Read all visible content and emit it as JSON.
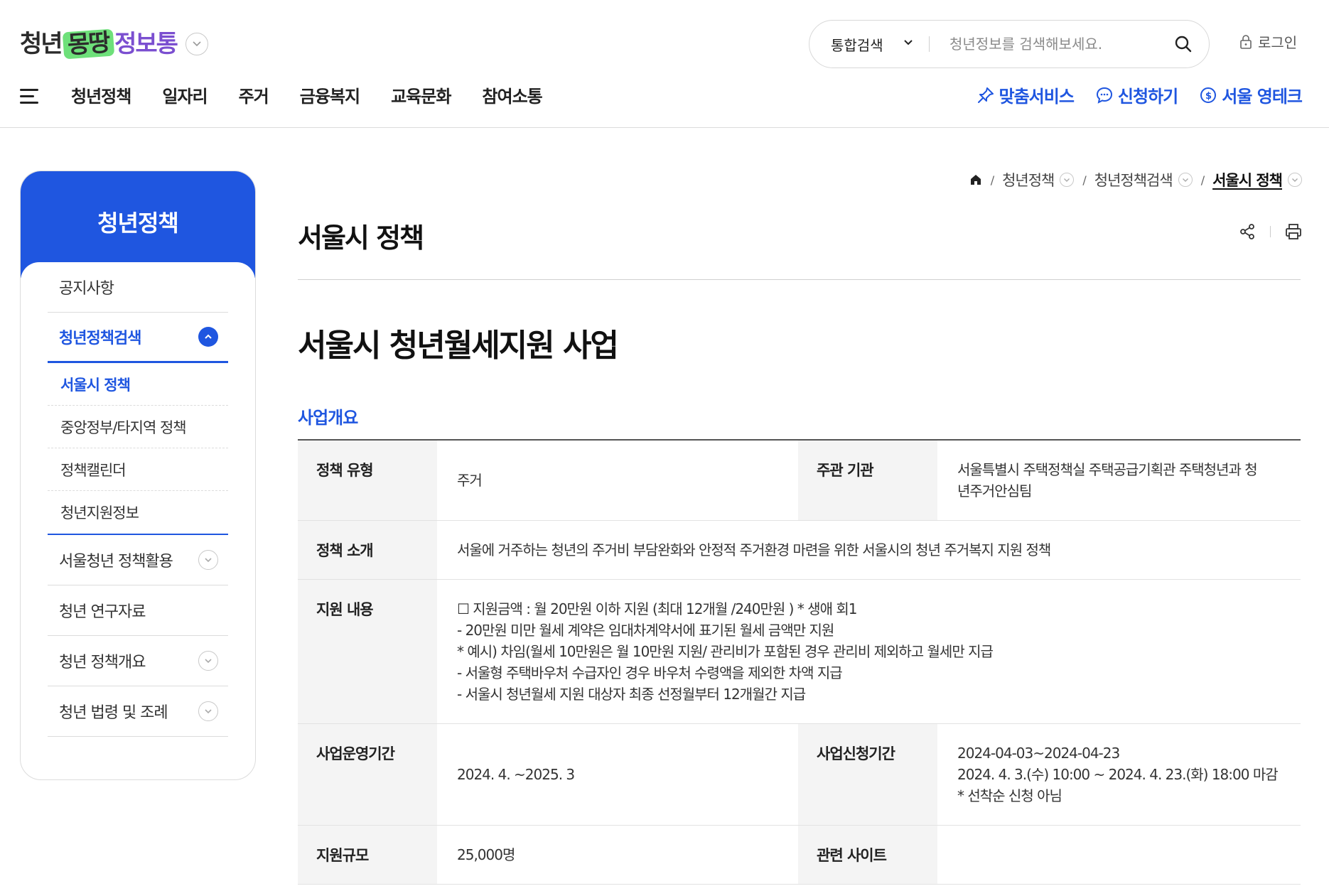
{
  "header": {
    "logo": {
      "part1": "청년",
      "part2": "몽땅",
      "part3": "정보통"
    },
    "search": {
      "scope": "통합검색",
      "placeholder": "청년정보를 검색해보세요."
    },
    "login_label": "로그인",
    "nav": [
      "청년정책",
      "일자리",
      "주거",
      "금융복지",
      "교육문화",
      "참여소통"
    ],
    "quick_links": [
      "맞춤서비스",
      "신청하기",
      "서울 영테크"
    ]
  },
  "sidebar": {
    "title": "청년정책",
    "items": [
      {
        "label": "공지사항"
      },
      {
        "label": "청년정책검색",
        "active": true,
        "sub": [
          {
            "label": "서울시 정책",
            "active": true
          },
          {
            "label": "중앙정부/타지역 정책"
          },
          {
            "label": "정책캘린더"
          },
          {
            "label": "청년지원정보"
          }
        ]
      },
      {
        "label": "서울청년 정책활용"
      },
      {
        "label": "청년 연구자료"
      },
      {
        "label": "청년 정책개요"
      },
      {
        "label": "청년 법령 및 조례"
      }
    ]
  },
  "breadcrumb": [
    "청년정책",
    "청년정책검색",
    "서울시 정책"
  ],
  "page": {
    "title": "서울시 정책",
    "policy_title": "서울시 청년월세지원 사업",
    "section_title": "사업개요",
    "table": {
      "policy_type_label": "정책 유형",
      "policy_type": "주거",
      "agency_label": "주관 기관",
      "agency_lines": [
        "서울특별시 주택정책실 주택공급기획관 주택청년과 청",
        "년주거안심팀"
      ],
      "intro_label": "정책 소개",
      "intro": "서울에 거주하는 청년의 주거비 부담완화와 안정적 주거환경 마련을 위한 서울시의 청년 주거복지 지원 정책",
      "support_label": "지원 내용",
      "support_lines": [
        "☐ 지원금액 : 월 20만원 이하 지원 (최대 12개월 /240만원 ) * 생애 회1",
        "- 20만원 미만 월세 계약은 임대차계약서에 표기된 월세 금액만 지원",
        "* 예시) 차임(월세 10만원은 월 10만원 지원/ 관리비가 포함된 경우 관리비 제외하고 월세만 지급",
        "- 서울형 주택바우처 수급자인 경우 바우처 수령액을 제외한 차액 지급",
        "- 서울시 청년월세 지원 대상자 최종 선정월부터 12개월간 지급"
      ],
      "operation_label": "사업운영기간",
      "operation": "2024. 4. ~2025. 3",
      "apply_label": "사업신청기간",
      "apply_lines": [
        "2024-04-03~2024-04-23",
        "2024. 4. 3.(수) 10:00 ~ 2024. 4. 23.(화) 18:00 마감",
        "* 선착순 신청 아님"
      ],
      "scale_label": "지원규모",
      "scale": "25,000명",
      "site_label": "관련 사이트",
      "site": ""
    }
  },
  "colors": {
    "accent": "#1f56e0",
    "logo_green": "#6ee07a",
    "logo_purple": "#7b4fd0"
  },
  "icons": [
    "chevron-down-icon",
    "search-icon",
    "lock-icon",
    "menu-icon",
    "pin-icon",
    "chat-icon",
    "coin-icon",
    "home-icon",
    "share-icon",
    "print-icon",
    "chevron-up-icon"
  ]
}
